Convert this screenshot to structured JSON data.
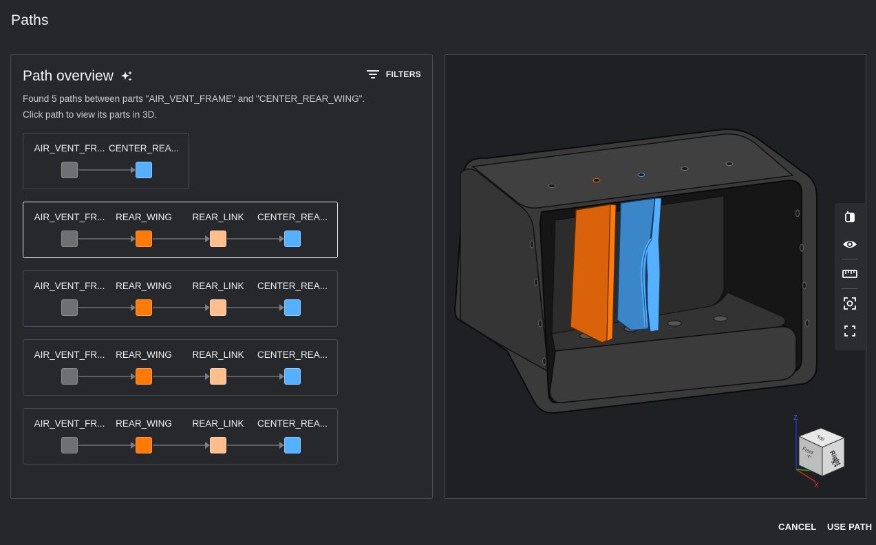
{
  "page": {
    "title": "Paths"
  },
  "overview": {
    "heading": "Path overview",
    "filters_label": "FILTERS",
    "description_line1": "Found 5 paths between parts \"AIR_VENT_FRAME\" and \"CENTER_REAR_WING\".",
    "description_line2": "Click path to view its parts in 3D."
  },
  "colors": {
    "gray": "#6f7072",
    "orange": "#ff7a07",
    "peach": "#ffbf8c",
    "blue": "#55b0ff"
  },
  "paths": [
    {
      "nodes": [
        {
          "label": "AIR_VENT_FR...",
          "color": "gray"
        },
        {
          "label": "CENTER_REA...",
          "color": "blue"
        }
      ]
    },
    {
      "selected": true,
      "nodes": [
        {
          "label": "AIR_VENT_FR...",
          "color": "gray"
        },
        {
          "label": "REAR_WING",
          "color": "orange"
        },
        {
          "label": "REAR_LINK",
          "color": "peach"
        },
        {
          "label": "CENTER_REA...",
          "color": "blue"
        }
      ]
    },
    {
      "nodes": [
        {
          "label": "AIR_VENT_FR...",
          "color": "gray"
        },
        {
          "label": "REAR_WING",
          "color": "orange"
        },
        {
          "label": "REAR_LINK",
          "color": "peach"
        },
        {
          "label": "CENTER_REA...",
          "color": "blue"
        }
      ]
    },
    {
      "nodes": [
        {
          "label": "AIR_VENT_FR...",
          "color": "gray"
        },
        {
          "label": "REAR_WING",
          "color": "orange"
        },
        {
          "label": "REAR_LINK",
          "color": "peach"
        },
        {
          "label": "CENTER_REA...",
          "color": "blue"
        }
      ]
    },
    {
      "nodes": [
        {
          "label": "AIR_VENT_FR...",
          "color": "gray"
        },
        {
          "label": "REAR_WING",
          "color": "orange"
        },
        {
          "label": "REAR_LINK",
          "color": "peach"
        },
        {
          "label": "CENTER_REA...",
          "color": "blue"
        }
      ]
    }
  ],
  "viewer": {
    "tools": [
      "section-view-icon",
      "visibility-eye-icon",
      "measure-ruler-icon",
      "focus-target-icon",
      "fullscreen-icon"
    ],
    "view_cube": {
      "axis_z": "Z",
      "axis_x": "X",
      "face_right": "Right",
      "face_right_sub": "X+",
      "face_front": "Front",
      "face_front_sub": "Y-",
      "face_top": "Top"
    }
  },
  "footer": {
    "cancel_label": "CANCEL",
    "use_path_label": "USE PATH"
  }
}
